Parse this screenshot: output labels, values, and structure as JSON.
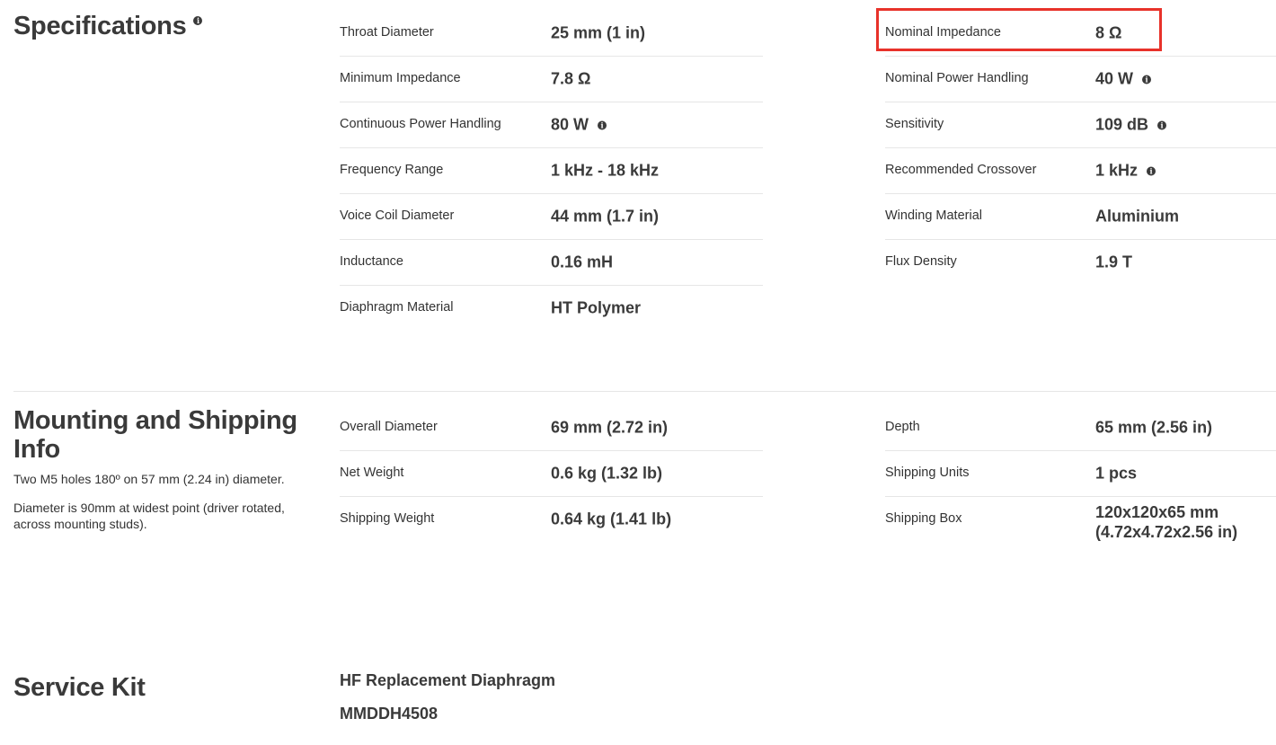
{
  "specifications": {
    "title": "Specifications",
    "left": [
      {
        "label": "Throat Diameter",
        "value": "25 mm (1 in)",
        "info": false
      },
      {
        "label": "Minimum Impedance",
        "value": "7.8 Ω",
        "info": false
      },
      {
        "label": "Continuous Power Handling",
        "value": "80 W",
        "info": true
      },
      {
        "label": "Frequency Range",
        "value": "1 kHz - 18 kHz",
        "info": false
      },
      {
        "label": "Voice Coil Diameter",
        "value": "44 mm (1.7 in)",
        "info": false
      },
      {
        "label": "Inductance",
        "value": "0.16 mH",
        "info": false
      },
      {
        "label": "Diaphragm Material",
        "value": "HT Polymer",
        "info": false
      }
    ],
    "right": [
      {
        "label": "Nominal Impedance",
        "value": "8 Ω",
        "info": false
      },
      {
        "label": "Nominal Power Handling",
        "value": "40 W",
        "info": true
      },
      {
        "label": "Sensitivity",
        "value": "109 dB",
        "info": true
      },
      {
        "label": "Recommended Crossover",
        "value": "1 kHz",
        "info": true
      },
      {
        "label": "Winding Material",
        "value": "Aluminium",
        "info": false
      },
      {
        "label": "Flux Density",
        "value": "1.9 T",
        "info": false
      }
    ]
  },
  "mounting": {
    "title_line1": "Mounting and Shipping",
    "title_line2": "Info",
    "note1": "Two M5 holes 180º on 57 mm (2.24 in) diameter.",
    "note2": "Diameter is 90mm at widest point (driver rotated, across mounting studs).",
    "left": [
      {
        "label": "Overall Diameter",
        "value": "69 mm (2.72 in)"
      },
      {
        "label": "Net Weight",
        "value": "0.6 kg (1.32 lb)"
      },
      {
        "label": "Shipping Weight",
        "value": "0.64 kg (1.41 lb)"
      }
    ],
    "right": [
      {
        "label": "Depth",
        "value": "65 mm (2.56 in)"
      },
      {
        "label": "Shipping Units",
        "value": "1 pcs"
      },
      {
        "label": "Shipping Box",
        "value_line1": "120x120x65 mm",
        "value_line2": "(4.72x4.72x2.56 in)"
      }
    ]
  },
  "service_kit": {
    "title": "Service Kit",
    "item_name": "HF Replacement Diaphragm",
    "item_code": "MMDDH4508"
  },
  "icons": {
    "info": "info-circle-icon"
  },
  "colors": {
    "highlight": "#e8322a",
    "text": "#3a3a3a",
    "divider": "#e6e6e6"
  }
}
